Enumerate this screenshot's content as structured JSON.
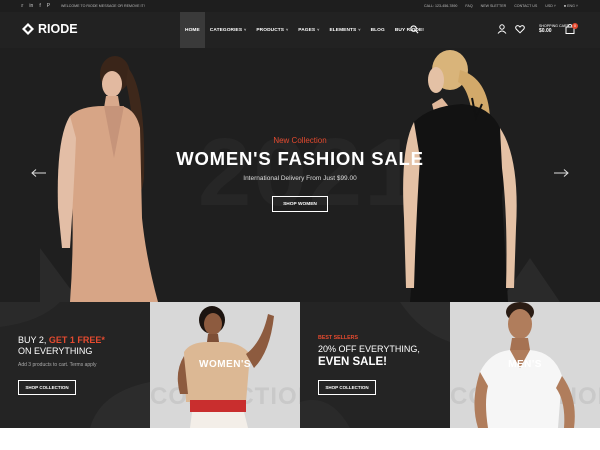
{
  "topbar": {
    "welcome": "WELCOME TO RIODE MESSAGE OR REMOVE IT!",
    "phone": "CALL: 123-456-7890",
    "faq": "FAQ",
    "newsletter": "NEW SLETTER",
    "contact": "CONTACT US",
    "currency": "USD",
    "language": "ENG"
  },
  "header": {
    "logo": "RIODE",
    "nav": [
      {
        "label": "HOME",
        "dropdown": false
      },
      {
        "label": "CATEGORIES",
        "dropdown": true
      },
      {
        "label": "PRODUCTS",
        "dropdown": true
      },
      {
        "label": "PAGES",
        "dropdown": true
      },
      {
        "label": "ELEMENTS",
        "dropdown": true
      },
      {
        "label": "BLOG",
        "dropdown": false
      },
      {
        "label": "BUY RIODE!",
        "dropdown": false
      }
    ],
    "cart_label": "SHOPPING CART:",
    "cart_total": "$0.00",
    "cart_count": "0"
  },
  "hero": {
    "year": "2021",
    "eyebrow": "New Collection",
    "headline": "WOMEN'S FASHION SALE",
    "sub": "International Delivery From Just $99.00",
    "cta": "SHOP WOMEN"
  },
  "tiles": {
    "promo1": {
      "line1_prefix": "BUY 2,",
      "line1_highlight": "GET 1 FREE*",
      "line2": "ON EVERYTHING",
      "small": "Add 3 products to cart. Terms apply",
      "button": "SHOP COLLECTION"
    },
    "womens": {
      "label": "WOMEN'S",
      "watermark": "COLLECTION"
    },
    "promo2": {
      "eyebrow": "BEST SELLERS",
      "line1": "20% OFF EVERYTHING,",
      "line2": "EVEN SALE!",
      "button": "SHOP COLLECTION"
    },
    "mens": {
      "label": "MEN'S",
      "watermark": "COLLECTION"
    }
  },
  "colors": {
    "accent": "#e44a2f",
    "dark": "#222222"
  }
}
